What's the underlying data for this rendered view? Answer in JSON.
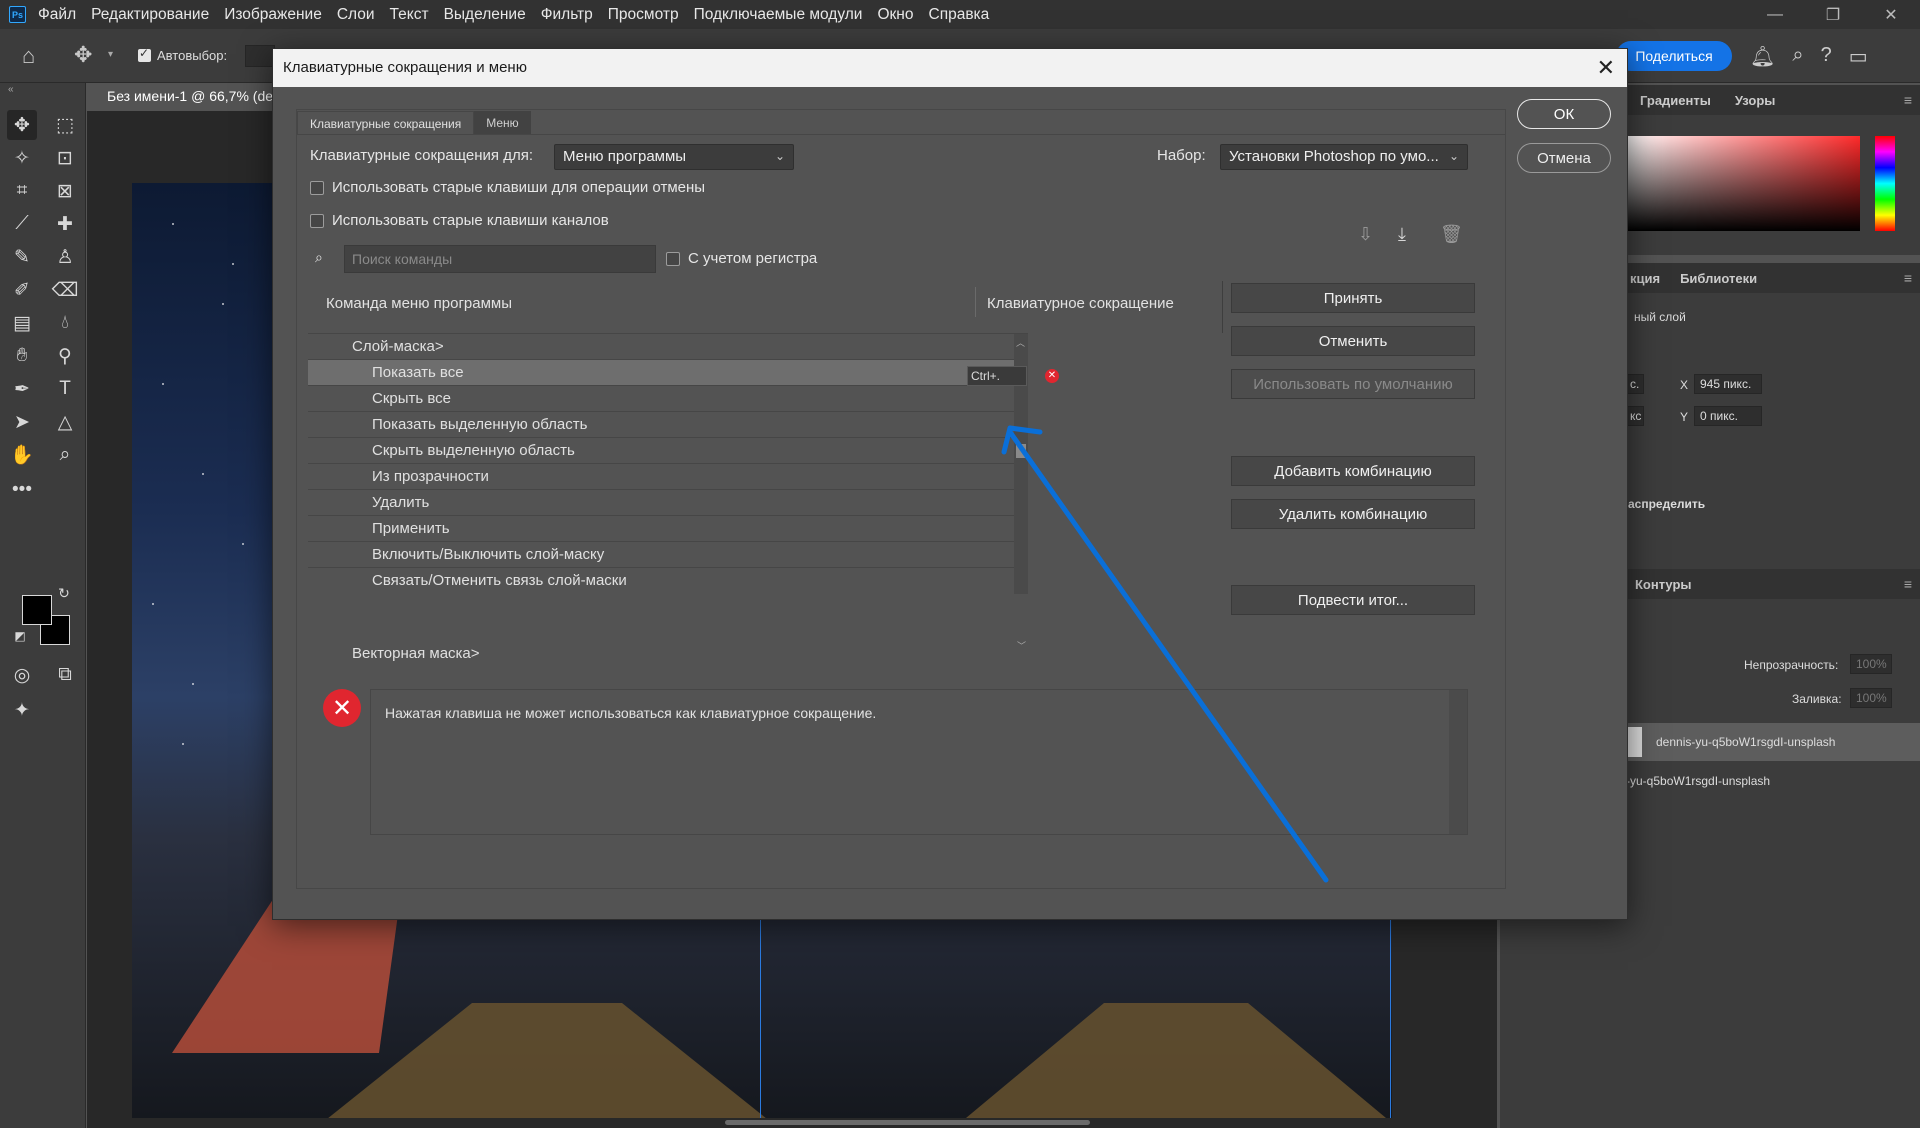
{
  "app": {
    "logo": "Ps",
    "menu": [
      "Файл",
      "Редактирование",
      "Изображение",
      "Слои",
      "Текст",
      "Выделение",
      "Фильтр",
      "Просмотр",
      "Подключаемые модули",
      "Окно",
      "Справка"
    ],
    "window_controls": [
      "—",
      "❐",
      "✕"
    ]
  },
  "options_bar": {
    "auto_select_label": "Автовыбор:",
    "share_label": "Поделиться"
  },
  "document": {
    "tab_title": "Без имени-1 @ 66,7% (de"
  },
  "right_panel": {
    "gradient_tabs": [
      "Градиенты",
      "Узоры"
    ],
    "properties_tabs": [
      "кция",
      "Библиотеки"
    ],
    "layer_type": "ный слой",
    "x_label": "X",
    "x_value": "945 пикс.",
    "y_label": "Y",
    "y_value": "0 пикс.",
    "w_fragment": "с.",
    "h_fragment": "кс",
    "distribute_label": "аспределить",
    "layers_tab": "Контуры",
    "opacity_label": "Непрозрачность:",
    "opacity_value": "100%",
    "fill_label": "Заливка:",
    "fill_value": "100%",
    "layers": [
      "dennis-yu-q5boW1rsgdI-unsplash",
      "s-yu-q5boW1rsgdI-unsplash"
    ]
  },
  "dialog": {
    "title": "Клавиатурные сокращения и меню",
    "tabs": [
      "Клавиатурные сокращения",
      "Меню"
    ],
    "shortcuts_for_label": "Клавиатурные сокращения для:",
    "shortcuts_for_value": "Меню программы",
    "set_label": "Набор:",
    "set_value": "Установки Photoshop по умо...",
    "use_legacy_undo": "Использовать старые клавиши для операции отмены",
    "use_legacy_channels": "Использовать старые клавиши каналов",
    "search_placeholder": "Поиск команды",
    "match_case": "С учетом регистра",
    "col_command": "Команда меню программы",
    "col_shortcut": "Клавиатурное сокращение",
    "rows": [
      {
        "label": "Слой-маска>",
        "level": 1
      },
      {
        "label": "Показать все",
        "level": 2,
        "shortcut": "Ctrl+."
      },
      {
        "label": "Скрыть все",
        "level": 2
      },
      {
        "label": "Показать выделенную область",
        "level": 2
      },
      {
        "label": "Скрыть выделенную область",
        "level": 2
      },
      {
        "label": "Из прозрачности",
        "level": 2
      },
      {
        "label": "Удалить",
        "level": 2
      },
      {
        "label": "Применить",
        "level": 2
      },
      {
        "label": "Включить/Выключить слой-маску",
        "level": 2
      },
      {
        "label": "Связать/Отменить связь слой-маски",
        "level": 2
      },
      {
        "label": "Векторная маска>",
        "level": 1
      }
    ],
    "ok_label": "ОК",
    "cancel_label": "Отмена",
    "accept_label": "Принять",
    "undo_label": "Отменить",
    "use_default_label": "Использовать по умолчанию",
    "add_shortcut_label": "Добавить комбинацию",
    "delete_shortcut_label": "Удалить комбинацию",
    "summarize_label": "Подвести итог...",
    "message": "Нажатая клавиша не может использоваться как клавиатурное сокращение."
  },
  "colors": {
    "accent": "#1473e6",
    "error": "#e0262f",
    "annotation_arrow": "#0a6fd8"
  }
}
